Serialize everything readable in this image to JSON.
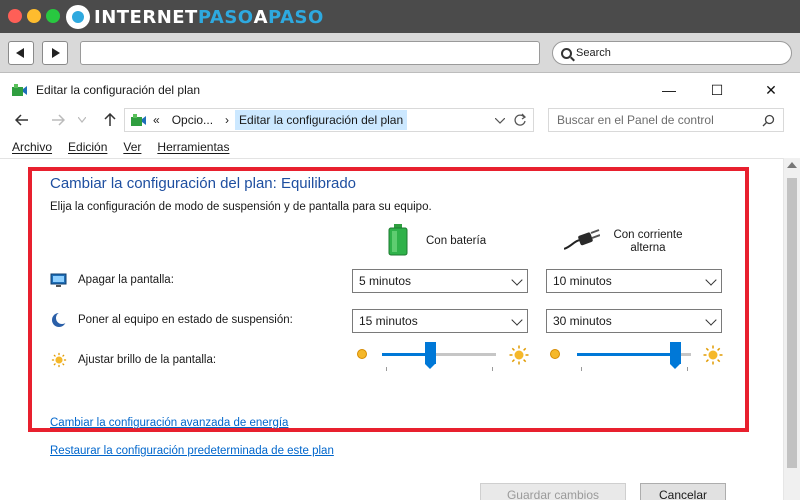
{
  "brand": {
    "part1": "INTERNET",
    "part2": "PASO",
    "part3": "A",
    "part4": "PASO"
  },
  "browser": {
    "search_label": "Search"
  },
  "window": {
    "title": "Editar la configuración del plan",
    "minimize": "—",
    "maximize": "☐",
    "close": "✕"
  },
  "address": {
    "prefix": "«",
    "crumb1": "Opcio...",
    "separator": "›",
    "crumb2": "Editar la configuración del plan",
    "search_placeholder": "Buscar en el Panel de control"
  },
  "menu": [
    "Archivo",
    "Edición",
    "Ver",
    "Herramientas"
  ],
  "plan": {
    "heading": "Cambiar la configuración del plan: Equilibrado",
    "subtitle": "Elija la configuración de modo de suspensión y de pantalla para su equipo.",
    "col_battery": "Con batería",
    "col_ac_line1": "Con corriente",
    "col_ac_line2": "alterna",
    "rows": {
      "display": {
        "label": "Apagar la pantalla:",
        "battery": "5 minutos",
        "ac": "10 minutos"
      },
      "sleep": {
        "label": "Poner al equipo en estado de suspensión:",
        "battery": "15 minutos",
        "ac": "30 minutos"
      },
      "brightness": {
        "label": "Ajustar brillo de la pantalla:",
        "battery_level": 0.42,
        "ac_level": 0.9
      }
    },
    "link_advanced": "Cambiar la configuración avanzada de energía",
    "link_restore": "Restaurar la configuración predeterminada de este plan"
  },
  "buttons": {
    "save": "Guardar cambios",
    "cancel": "Cancelar"
  },
  "colors": {
    "accent": "#0078d7",
    "heading": "#1e4fa0",
    "link": "#0066cc",
    "frame": "#e8202e"
  }
}
